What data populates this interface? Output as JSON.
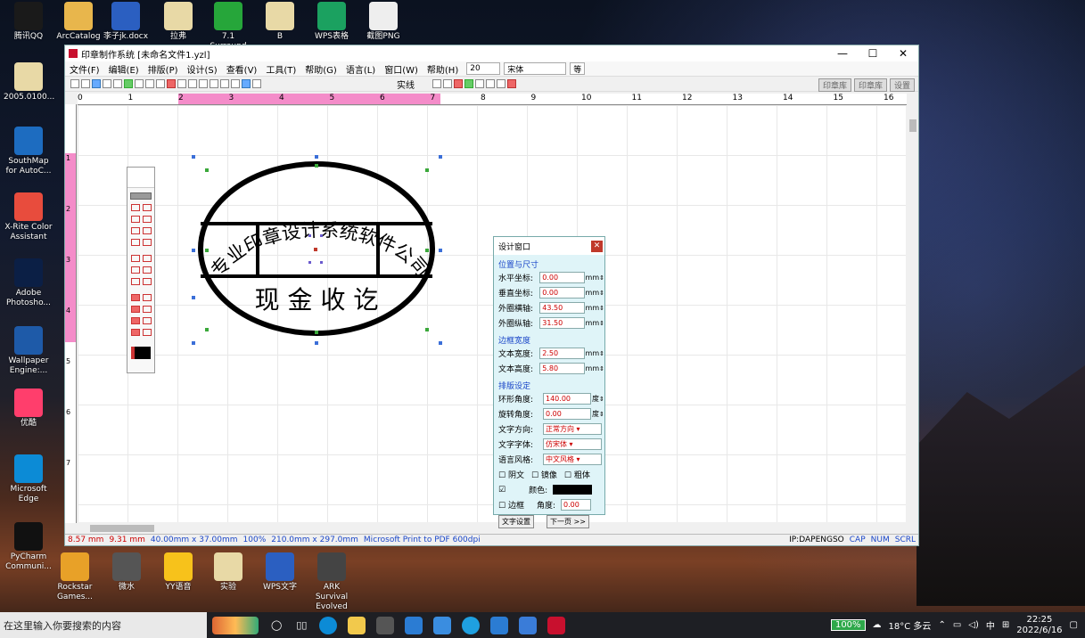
{
  "desktop": {
    "icons": [
      {
        "label": "腾讯QQ",
        "color": "#1a1a1a"
      },
      {
        "label": "ArcCatalog",
        "color": "#e8b64c"
      },
      {
        "label": "李子jk.docx",
        "color": "#2b5fc1"
      },
      {
        "label": "拉弗",
        "color": "#e8d9a6"
      },
      {
        "label": "7.1 Surround",
        "color": "#26a63a"
      },
      {
        "label": "B",
        "color": "#e8d9a6"
      },
      {
        "label": "WPS表格",
        "color": "#1ba160"
      },
      {
        "label": "截图PNG",
        "color": "#eee"
      },
      {
        "label": "2005.0100...",
        "color": "#e8d9a6"
      },
      {
        "label": "SouthMap for AutoC...",
        "color": "#1d6cc0"
      },
      {
        "label": "X-Rite Color Assistant",
        "color": "#e84c3d"
      },
      {
        "label": "Adobe Photosho...",
        "color": "#0b1f45"
      },
      {
        "label": "Wallpaper Engine:...",
        "color": "#1e5aa8"
      },
      {
        "label": "优酷",
        "color": "#ff3e6c"
      },
      {
        "label": "Microsoft Edge",
        "color": "#0c8bd6"
      },
      {
        "label": "PyCharm Communi...",
        "color": "#111"
      },
      {
        "label": "Rockstar Games...",
        "color": "#e8a128"
      },
      {
        "label": "微水",
        "color": "#555"
      },
      {
        "label": "YY语音",
        "color": "#f7c21b"
      },
      {
        "label": "实验",
        "color": "#e8d9a6"
      },
      {
        "label": "WPS文字",
        "color": "#2b5fc1"
      },
      {
        "label": "ARK Survival Evolved",
        "color": "#444"
      }
    ]
  },
  "window": {
    "title": "印章制作系统 [未命名文件1.yzl]",
    "menu": [
      "文件(F)",
      "编辑(E)",
      "排版(P)",
      "设计(S)",
      "查看(V)",
      "工具(T)",
      "帮助(G)",
      "语言(L)",
      "窗口(W)",
      "帮助(H)"
    ],
    "font_size": "20",
    "font_name": "宋体",
    "bold_label": "等",
    "fill_combo": "实线",
    "right_tabs": [
      "印章库",
      "印章库",
      "设置"
    ],
    "ruler_h": [
      "0",
      "1",
      "2",
      "3",
      "4",
      "5",
      "6",
      "7",
      "8",
      "9",
      "10",
      "11",
      "12",
      "13",
      "14",
      "15",
      "16"
    ],
    "ruler_v": [
      "1",
      "2",
      "3",
      "4",
      "5",
      "6",
      "7"
    ]
  },
  "seal": {
    "arc_text": "专业印章设计系统软件公司",
    "bottom_text": "现 金 收 讫"
  },
  "panel": {
    "title": "设计窗口",
    "section_position": "位置与尺寸",
    "fields": [
      {
        "label": "水平坐标:",
        "value": "0.00",
        "unit": "mm"
      },
      {
        "label": "垂直坐标:",
        "value": "0.00",
        "unit": "mm"
      },
      {
        "label": "外圈横轴:",
        "value": "43.50",
        "unit": "mm"
      },
      {
        "label": "外圈纵轴:",
        "value": "31.50",
        "unit": "mm"
      }
    ],
    "section_border": "边框宽度",
    "border_fields": [
      {
        "label": "文本宽度:",
        "value": "2.50",
        "unit": "mm"
      },
      {
        "label": "文本高度:",
        "value": "5.80",
        "unit": "mm"
      }
    ],
    "section_text": "排版设定",
    "text_fields": [
      {
        "label": "环形角度:",
        "value": "140.00",
        "unit": "度"
      },
      {
        "label": "旋转角度:",
        "value": "0.00",
        "unit": "度"
      }
    ],
    "selects": [
      {
        "label": "文字方向:",
        "value": "正常方向"
      },
      {
        "label": "文字字体:",
        "value": "仿宋体"
      },
      {
        "label": "语言风格:",
        "value": "中文风格"
      }
    ],
    "checks": [
      "阴文",
      "镜像",
      "粗体"
    ],
    "color_label": "颜色:",
    "border_check": "边框",
    "angle_label": "角度:",
    "angle_value": "0.00",
    "btn_prev": "文字设置",
    "btn_next": "下一页 >>"
  },
  "status": {
    "x": "8.57 mm",
    "y": "9.31 mm",
    "size": "40.00mm x 37.00mm",
    "zoom": "100%",
    "page": "210.0mm x 297.0mm",
    "printer": "Microsoft Print to PDF 600dpi",
    "machine": "IP:DAPENGSO",
    "caps": "CAP",
    "num": "NUM",
    "scrl": "SCRL"
  },
  "taskbar": {
    "search_placeholder": "在这里输入你要搜索的内容",
    "battery": "100%",
    "weather": "18°C 多云",
    "ime": "中",
    "time": "22:25",
    "date": "2022/6/16"
  }
}
